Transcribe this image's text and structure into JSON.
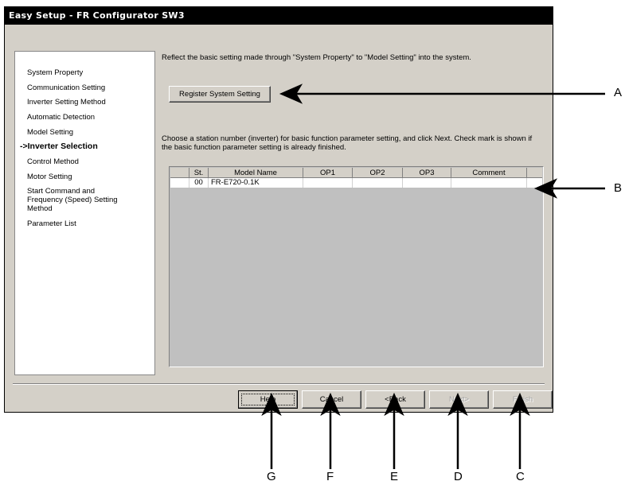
{
  "window": {
    "title": "Easy Setup - FR Configurator SW3"
  },
  "sidebar": {
    "items": [
      {
        "label": "System Property"
      },
      {
        "label": "Communication Setting"
      },
      {
        "label": "Inverter Setting Method"
      },
      {
        "label": "Automatic Detection"
      },
      {
        "label": "Model Setting"
      },
      {
        "label": "->Inverter Selection",
        "active": true
      },
      {
        "label": "Control Method"
      },
      {
        "label": "Motor Setting"
      },
      {
        "label": "Start Command and Frequency (Speed) Setting Method"
      },
      {
        "label": "Parameter List"
      }
    ]
  },
  "main": {
    "reflect_text": "Reflect the basic setting made through \"System Property\" to \"Model Setting\" into the system.",
    "register_button": "Register System Setting",
    "choose_text": "Choose a station number (inverter) for basic function parameter setting, and click Next. Check mark is shown if the basic function parameter setting is already finished.",
    "table": {
      "columns": [
        "",
        "St.",
        "Model Name",
        "OP1",
        "OP2",
        "OP3",
        "Comment"
      ],
      "rows": [
        [
          "",
          "00",
          "FR-E720-0.1K",
          "",
          "",
          "",
          ""
        ]
      ]
    }
  },
  "footer": {
    "help": "Help",
    "cancel": "Cancel",
    "back": "<Back",
    "next": "Next>",
    "finish": "Finish"
  },
  "callouts": [
    "A",
    "B",
    "C",
    "D",
    "E",
    "F",
    "G"
  ],
  "colors": {
    "window_bg": "#d4d0c8",
    "titlebar": "#000000",
    "grid_bg": "#c0c0c0"
  }
}
